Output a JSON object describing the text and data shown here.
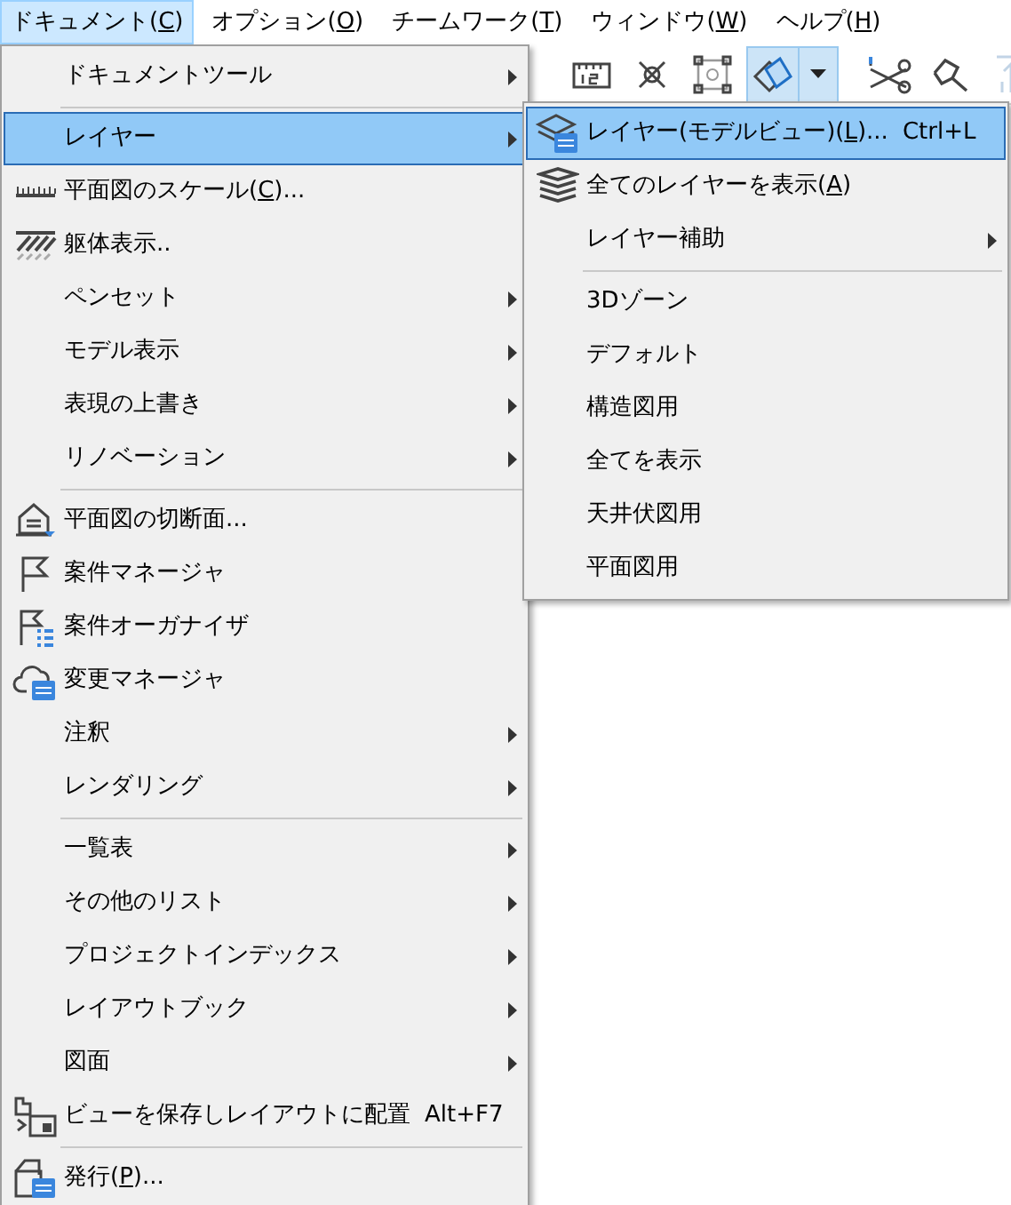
{
  "menubar": [
    {
      "label": [
        "ドキュメント(",
        "C",
        ")"
      ],
      "selected": true
    },
    {
      "label": [
        "オプション(",
        "O",
        ")"
      ],
      "selected": false
    },
    {
      "label": [
        "チームワーク(",
        "T",
        ")"
      ],
      "selected": false
    },
    {
      "label": [
        "ウィンドウ(",
        "W",
        ")"
      ],
      "selected": false
    },
    {
      "label": [
        "ヘルプ(",
        "H",
        ")"
      ],
      "selected": false
    }
  ],
  "toolbar": {
    "buttons": [
      {
        "selected": false,
        "disabled": false,
        "has_dropdown": false
      },
      {
        "selected": false,
        "disabled": false,
        "has_dropdown": false
      },
      {
        "selected": false,
        "disabled": false,
        "has_dropdown": false
      },
      {
        "selected": true,
        "disabled": false,
        "has_dropdown": true
      },
      {
        "selected": false,
        "disabled": false,
        "has_dropdown": false
      },
      {
        "selected": false,
        "disabled": false,
        "has_dropdown": false
      },
      {
        "selected": false,
        "disabled": true,
        "has_dropdown": false
      }
    ]
  },
  "menu": {
    "items": [
      {
        "kind": "item",
        "label": "ドキュメントツール",
        "has_submenu": true,
        "selected": false
      },
      {
        "kind": "separator"
      },
      {
        "kind": "item",
        "label": "レイヤー",
        "has_submenu": true,
        "selected": true
      },
      {
        "kind": "item",
        "label": [
          "平面図のスケール(",
          "C",
          ")..."
        ],
        "has_submenu": false,
        "selected": false
      },
      {
        "kind": "item",
        "label": "躯体表示..",
        "has_submenu": false,
        "selected": false
      },
      {
        "kind": "item",
        "label": "ペンセット",
        "has_submenu": true,
        "selected": false
      },
      {
        "kind": "item",
        "label": "モデル表示",
        "has_submenu": true,
        "selected": false
      },
      {
        "kind": "item",
        "label": "表現の上書き",
        "has_submenu": true,
        "selected": false
      },
      {
        "kind": "item",
        "label": "リノベーション",
        "has_submenu": true,
        "selected": false
      },
      {
        "kind": "separator"
      },
      {
        "kind": "item",
        "label": "平面図の切断面...",
        "has_submenu": false,
        "selected": false
      },
      {
        "kind": "item",
        "label": "案件マネージャ",
        "has_submenu": false,
        "selected": false
      },
      {
        "kind": "item",
        "label": "案件オーガナイザ",
        "has_submenu": false,
        "selected": false
      },
      {
        "kind": "item",
        "label": "変更マネージャ",
        "has_submenu": false,
        "selected": false
      },
      {
        "kind": "item",
        "label": "注釈",
        "has_submenu": true,
        "selected": false
      },
      {
        "kind": "item",
        "label": "レンダリング",
        "has_submenu": true,
        "selected": false
      },
      {
        "kind": "separator"
      },
      {
        "kind": "item",
        "label": "一覧表",
        "has_submenu": true,
        "selected": false
      },
      {
        "kind": "item",
        "label": "その他のリスト",
        "has_submenu": true,
        "selected": false
      },
      {
        "kind": "item",
        "label": "プロジェクトインデックス",
        "has_submenu": true,
        "selected": false
      },
      {
        "kind": "item",
        "label": "レイアウトブック",
        "has_submenu": true,
        "selected": false
      },
      {
        "kind": "item",
        "label": "図面",
        "has_submenu": true,
        "selected": false
      },
      {
        "kind": "item",
        "label": "ビューを保存しレイアウトに配置",
        "shortcut": "Alt+F7",
        "has_submenu": false,
        "selected": false
      },
      {
        "kind": "separator"
      },
      {
        "kind": "item",
        "label": [
          "発行(",
          "P",
          ")..."
        ],
        "has_submenu": false,
        "selected": false
      }
    ]
  },
  "submenu": {
    "items": [
      {
        "kind": "item",
        "label": [
          "レイヤー(モデルビュー)(",
          "L",
          ")..."
        ],
        "shortcut": "Ctrl+L",
        "has_submenu": false,
        "selected": true
      },
      {
        "kind": "item",
        "label": [
          "全てのレイヤーを表示(",
          "A",
          ")"
        ],
        "has_submenu": false,
        "selected": false
      },
      {
        "kind": "item",
        "label": "レイヤー補助",
        "has_submenu": true,
        "selected": false
      },
      {
        "kind": "separator"
      },
      {
        "kind": "item",
        "label": "3Dゾーン",
        "has_submenu": false,
        "selected": false
      },
      {
        "kind": "item",
        "label": "デフォルト",
        "has_submenu": false,
        "selected": false
      },
      {
        "kind": "item",
        "label": "構造図用",
        "has_submenu": false,
        "selected": false
      },
      {
        "kind": "item",
        "label": "全てを表示",
        "has_submenu": false,
        "selected": false
      },
      {
        "kind": "item",
        "label": "天井伏図用",
        "has_submenu": false,
        "selected": false
      },
      {
        "kind": "item",
        "label": "平面図用",
        "has_submenu": false,
        "selected": false
      }
    ]
  }
}
